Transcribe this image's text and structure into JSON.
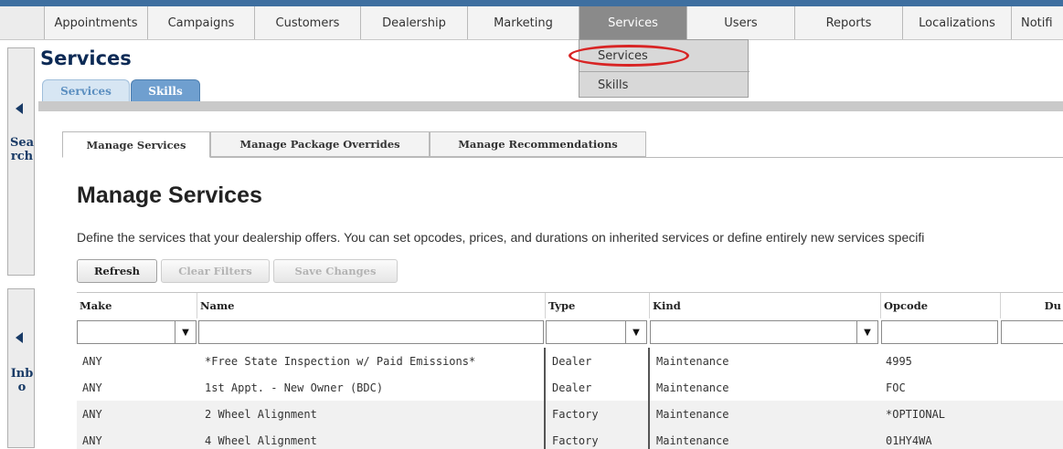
{
  "nav": {
    "items": [
      "Appointments",
      "Campaigns",
      "Customers",
      "Dealership",
      "Marketing",
      "Services",
      "Users",
      "Reports",
      "Localizations",
      "Notifi"
    ],
    "active": "Services",
    "dropdown": [
      "Services",
      "Skills"
    ]
  },
  "page": {
    "title": "Services",
    "subtabs": [
      "Services",
      "Skills"
    ]
  },
  "sidepanels": {
    "search_label": "Search",
    "inbox_label": "Inbo"
  },
  "manage_tabs": [
    "Manage Services",
    "Manage Package Overrides",
    "Manage Recommendations"
  ],
  "heading": "Manage Services",
  "description": "Define the services that your dealership offers. You can set opcodes, prices, and durations on inherited services or define entirely new services specifi",
  "buttons": {
    "refresh": "Refresh",
    "clear_filters": "Clear Filters",
    "save_changes": "Save Changes"
  },
  "table": {
    "columns": [
      "Make",
      "Name",
      "Type",
      "Kind",
      "Opcode",
      "Du"
    ],
    "rows": [
      {
        "make": "ANY",
        "name": "*Free State Inspection w/ Paid Emissions*",
        "type": "Dealer",
        "kind": "Maintenance",
        "opcode": "4995"
      },
      {
        "make": "ANY",
        "name": "1st Appt. - New Owner (BDC)",
        "type": "Dealer",
        "kind": "Maintenance",
        "opcode": "FOC"
      },
      {
        "make": "ANY",
        "name": "2 Wheel Alignment",
        "type": "Factory",
        "kind": "Maintenance",
        "opcode": "*OPTIONAL"
      },
      {
        "make": "ANY",
        "name": "4 Wheel Alignment",
        "type": "Factory",
        "kind": "Maintenance",
        "opcode": "01HY4WA"
      }
    ]
  },
  "colors": {
    "nav_stripe": "#3e6fa0",
    "title": "#0c2a55",
    "highlight_circle": "#d82424"
  }
}
